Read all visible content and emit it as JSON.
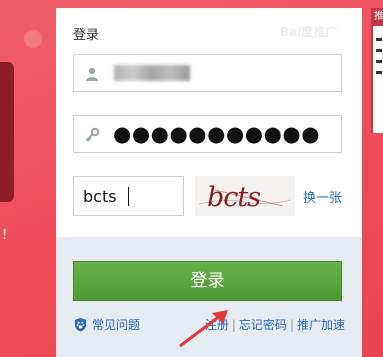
{
  "form": {
    "title": "登录",
    "watermark": "Bai度推广",
    "username_icon": "user-icon",
    "password_icon": "key-icon",
    "password_mask": "●●●●●●●●●●●",
    "captcha_value": "bcts",
    "captcha_image_text": "bcts",
    "refresh_label": "换一张",
    "login_label": "登录"
  },
  "footer": {
    "help_icon": "paw-icon",
    "help_label": "常见问题",
    "links": [
      "注册",
      "忘记密码",
      "推广加速"
    ]
  },
  "side_tab": {
    "label": "推"
  },
  "decoration": {
    "bang": "!"
  },
  "colors": {
    "background": "#ee4f5c",
    "button": "#5aa63f",
    "link": "#2a69c5",
    "annotation_arrow": "#e23a3a"
  }
}
